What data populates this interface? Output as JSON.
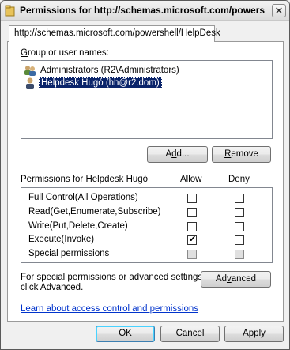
{
  "window": {
    "title": "Permissions for http://schemas.microsoft.com/powers…",
    "close_glyph": "✕"
  },
  "tab": {
    "label": "http://schemas.microsoft.com/powershell/HelpDesk"
  },
  "groups": {
    "label_prefix": "",
    "label_u": "G",
    "label_rest": "roup or user names:",
    "items": [
      {
        "name": "Administrators (R2\\Administrators)",
        "icon": "group-icon",
        "selected": false
      },
      {
        "name": "Helpdesk Hugó (hh@r2.dom)",
        "icon": "user-icon",
        "selected": true
      }
    ]
  },
  "buttons": {
    "add_pre": "A",
    "add_u": "d",
    "add_post": "d...",
    "remove_u": "R",
    "remove_post": "emove",
    "advanced_pre": "Ad",
    "advanced_u": "v",
    "advanced_post": "anced",
    "ok": "OK",
    "cancel": "Cancel",
    "apply_u": "A",
    "apply_post": "pply"
  },
  "permissions": {
    "header_u": "P",
    "header_rest": "ermissions for Helpdesk Hugó",
    "allow_header": "Allow",
    "deny_header": "Deny",
    "rows": [
      {
        "label": "Full Control(All Operations)",
        "allow": false,
        "deny": false,
        "disabled": false
      },
      {
        "label": "Read(Get,Enumerate,Subscribe)",
        "allow": false,
        "deny": false,
        "disabled": false
      },
      {
        "label": "Write(Put,Delete,Create)",
        "allow": false,
        "deny": false,
        "disabled": false
      },
      {
        "label": "Execute(Invoke)",
        "allow": true,
        "deny": false,
        "disabled": false
      },
      {
        "label": "Special permissions",
        "allow": false,
        "deny": false,
        "disabled": true
      }
    ]
  },
  "special": {
    "line1": "For special permissions or advanced settings,",
    "line2": "click Advanced."
  },
  "link": {
    "text": "Learn about access control and permissions"
  },
  "colors": {
    "selection": "#0a246a",
    "link": "#0033cc"
  }
}
